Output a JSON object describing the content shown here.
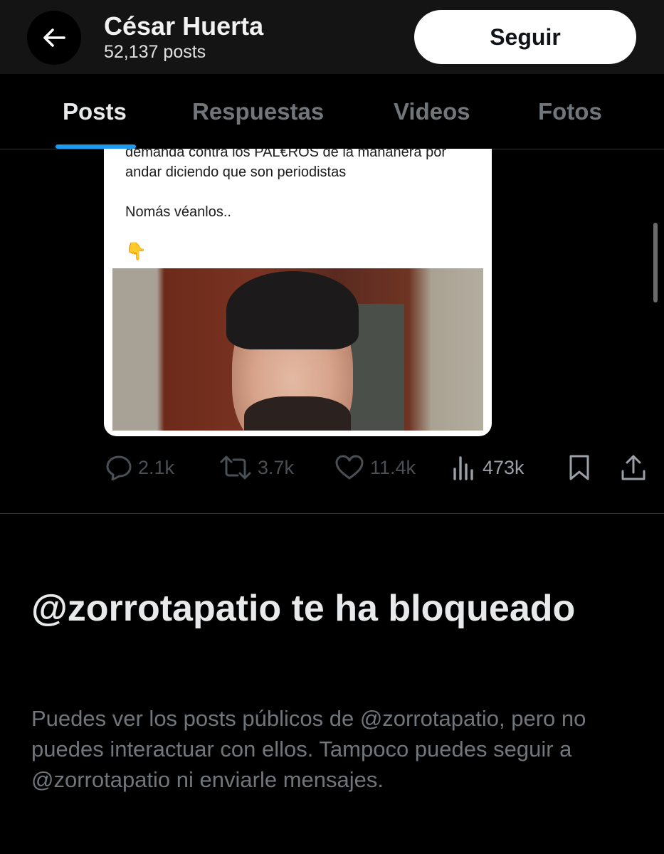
{
  "header": {
    "profile_name": "César Huerta",
    "post_count": "52,137 posts",
    "follow_label": "Seguir"
  },
  "tabs": [
    {
      "label": "Posts",
      "active": true
    },
    {
      "label": "Respuestas",
      "active": false
    },
    {
      "label": "Videos",
      "active": false
    },
    {
      "label": "Fotos",
      "active": false
    }
  ],
  "post": {
    "embed_lines": [
      "demanda contra los PAL€ROS de la mañanera por",
      "andar diciendo que son periodistas",
      "Nomás véanlos.."
    ],
    "embed_emoji": "👇",
    "actions": {
      "replies": "2.1k",
      "reposts": "3.7k",
      "likes": "11.4k",
      "views": "473k"
    }
  },
  "blocked": {
    "title": "@zorrotapatio te ha bloqueado",
    "description": "Puedes ver los posts públicos de @zorrotapatio, pero no puedes interactuar con ellos. Tampoco puedes seguir a @zorrotapatio ni enviarle mensajes."
  },
  "colors": {
    "accent": "#1d9bf0",
    "background": "#000000",
    "muted_text": "#71767b"
  }
}
